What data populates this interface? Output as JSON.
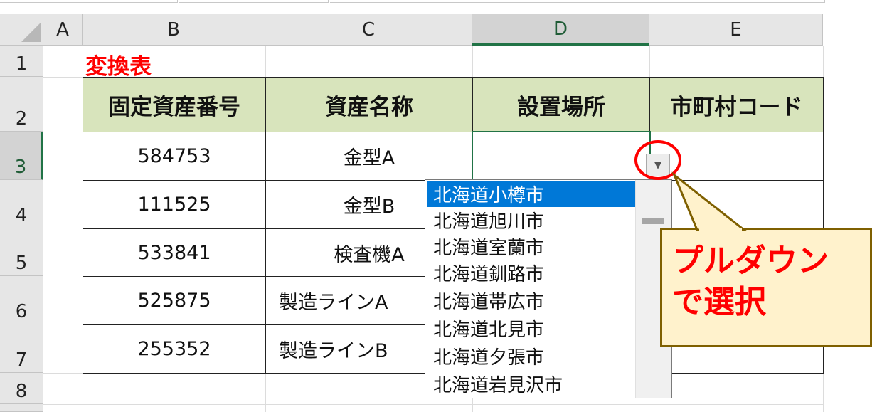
{
  "columns": [
    "A",
    "B",
    "C",
    "D",
    "E"
  ],
  "rows": [
    "1",
    "2",
    "3",
    "4",
    "5",
    "6",
    "7",
    "8"
  ],
  "title": "変換表",
  "headers": [
    "固定資産番号",
    "資産名称",
    "設置場所",
    "市町村コード"
  ],
  "data_rows": [
    {
      "number": "584753",
      "name": "金型A"
    },
    {
      "number": "111525",
      "name": "金型B"
    },
    {
      "number": "533841",
      "name": "検査機A"
    },
    {
      "number": "525875",
      "name": "製造ラインA"
    },
    {
      "number": "255352",
      "name": "製造ラインB"
    }
  ],
  "active_cell": "D3",
  "dropdown": {
    "button_icon": "chevron-down-icon",
    "items": [
      "北海道小樽市",
      "北海道旭川市",
      "北海道室蘭市",
      "北海道釧路市",
      "北海道帯広市",
      "北海道北見市",
      "北海道夕張市",
      "北海道岩見沢市"
    ],
    "highlighted_index": 0
  },
  "callout": {
    "line1": "プルダウン",
    "line2": "で選択"
  },
  "colors": {
    "header_fill": "#d8e4bc",
    "title": "#ff0000",
    "callout_fill": "#fff2cc",
    "callout_text": "#ff0000",
    "selection_green": "#217346",
    "dropdown_highlight": "#0078d7"
  }
}
